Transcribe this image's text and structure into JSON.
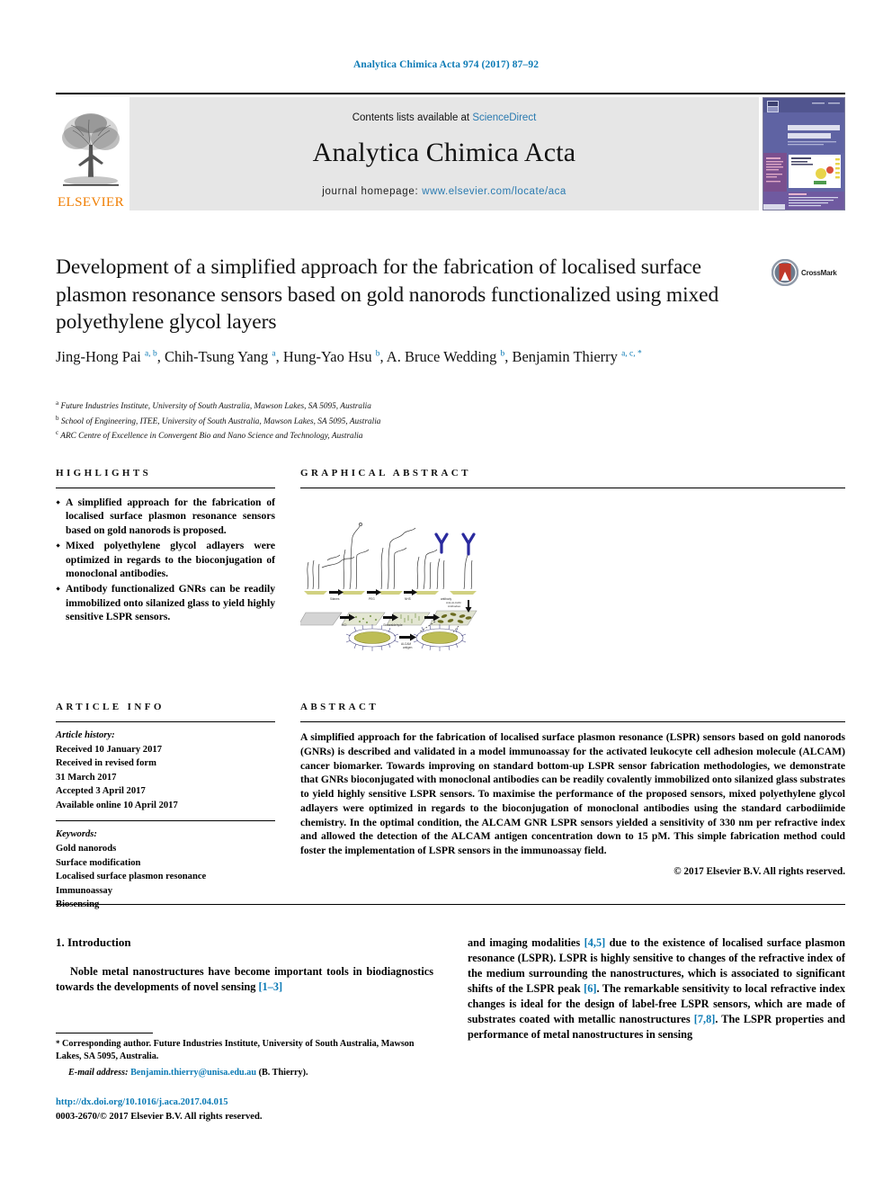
{
  "running_head": "Analytica Chimica Acta 974 (2017) 87–92",
  "masthead": {
    "publisher": "ELSEVIER",
    "contents_prefix": "Contents lists available at ",
    "contents_link": "ScienceDirect",
    "journal_title": "Analytica Chimica Acta",
    "homepage_label": "journal homepage: ",
    "homepage_url": "www.elsevier.com/locate/aca",
    "cover_journal_name": "ANALYTICA CHIMICA ACTA"
  },
  "article": {
    "title": "Development of a simplified approach for the fabrication of localised surface plasmon resonance sensors based on gold nanorods functionalized using mixed polyethylene glycol layers",
    "crossmark_label": "CrossMark",
    "authors_html": "Jing-Hong Pai <sup>a, b</sup>, Chih-Tsung Yang <sup>a</sup>, Hung-Yao Hsu <sup>b</sup>, A. Bruce Wedding <sup>b</sup>, Benjamin Thierry <sup>a, c, *</sup>",
    "affiliations": [
      {
        "marker": "a",
        "text": "Future Industries Institute, University of South Australia, Mawson Lakes, SA 5095, Australia"
      },
      {
        "marker": "b",
        "text": "School of Engineering, ITEE, University of South Australia, Mawson Lakes, SA 5095, Australia"
      },
      {
        "marker": "c",
        "text": "ARC Centre of Excellence in Convergent Bio and Nano Science and Technology, Australia"
      }
    ]
  },
  "highlights": {
    "label": "HIGHLIGHTS",
    "items": [
      "A simplified approach for the fabrication of localised surface plasmon resonance sensors based on gold nanorods is proposed.",
      "Mixed polyethylene glycol adlayers were optimized in regards to the bioconjugation of monoclonal antibodies.",
      "Antibody functionalized GNRs can be readily immobilized onto silanized glass to yield highly sensitive LSPR sensors."
    ]
  },
  "graphical_abstract": {
    "label": "GRAPHICAL ABSTRACT",
    "step_labels": [
      "Silanes",
      "PEG",
      "NHS",
      "antibody",
      "HCl",
      "Glutaraldehyde",
      "Anti-ALCAM antibodies",
      "ALCAM antigen"
    ]
  },
  "article_info": {
    "label": "ARTICLE INFO",
    "history_label": "Article history:",
    "history": [
      "Received 10 January 2017",
      "Received in revised form",
      "31 March 2017",
      "Accepted 3 April 2017",
      "Available online 10 April 2017"
    ],
    "keywords_label": "Keywords:",
    "keywords": [
      "Gold nanorods",
      "Surface modification",
      "Localised surface plasmon resonance",
      "Immunoassay",
      "Biosensing"
    ]
  },
  "abstract": {
    "label": "ABSTRACT",
    "text": "A simplified approach for the fabrication of localised surface plasmon resonance (LSPR) sensors based on gold nanorods (GNRs) is described and validated in a model immunoassay for the activated leukocyte cell adhesion molecule (ALCAM) cancer biomarker. Towards improving on standard bottom-up LSPR sensor fabrication methodologies, we demonstrate that GNRs bioconjugated with monoclonal antibodies can be readily covalently immobilized onto silanized glass substrates to yield highly sensitive LSPR sensors. To maximise the performance of the proposed sensors, mixed polyethylene glycol adlayers were optimized in regards to the bioconjugation of monoclonal antibodies using the standard carbodiimide chemistry. In the optimal condition, the ALCAM GNR LSPR sensors yielded a sensitivity of 330 nm per refractive index and allowed the detection of the ALCAM antigen concentration down to 15 pM. This simple fabrication method could foster the implementation of LSPR sensors in the immunoassay field.",
    "copyright": "© 2017 Elsevier B.V. All rights reserved."
  },
  "body": {
    "section_number_title": "1. Introduction",
    "left_paragraph_html": "Noble metal nanostructures have become important tools in biodiagnostics towards the developments of novel sensing <span class=\"ref\">[1–3]</span>",
    "right_paragraph_html": "and imaging modalities <span class=\"ref\">[4,5]</span> due to the existence of localised surface plasmon resonance (LSPR). LSPR is highly sensitive to changes of the refractive index of the medium surrounding the nanostructures, which is associated to significant shifts of the LSPR peak <span class=\"ref\">[6]</span>. The remarkable sensitivity to local refractive index changes is ideal for the design of label-free LSPR sensors, which are made of substrates coated with metallic nanostructures <span class=\"ref\">[7,8]</span>. The LSPR properties and performance of metal nanostructures in sensing"
  },
  "footnote": {
    "corresponding_html": "<span class=\"star\">*</span> Corresponding author. Future Industries Institute, University of South Australia, Mawson Lakes, SA 5095, Australia.",
    "email_label": "E-mail address:",
    "email": "Benjamin.thierry@unisa.edu.au",
    "email_owner": "(B. Thierry)."
  },
  "footer": {
    "doi": "http://dx.doi.org/10.1016/j.aca.2017.04.015",
    "issn_line": "0003-2670/© 2017 Elsevier B.V. All rights reserved."
  },
  "colors": {
    "link_blue": "#0b7ab5",
    "elsevier_orange": "#f07d00",
    "band_gray": "#e6e6e6",
    "cover_purple": "#5b5f9e"
  }
}
